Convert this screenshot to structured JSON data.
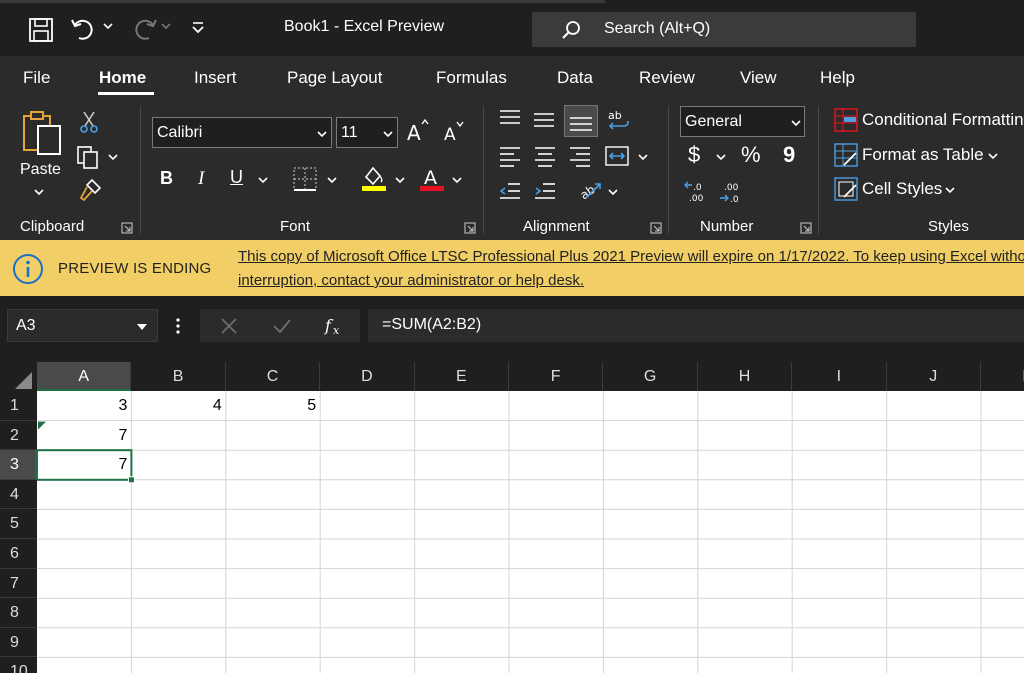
{
  "titlebar": {
    "title": "Book1  -  Excel Preview",
    "search_placeholder": "Search (Alt+Q)"
  },
  "tabs": [
    {
      "label": "File"
    },
    {
      "label": "Home",
      "active": true
    },
    {
      "label": "Insert"
    },
    {
      "label": "Page Layout"
    },
    {
      "label": "Formulas"
    },
    {
      "label": "Data"
    },
    {
      "label": "Review"
    },
    {
      "label": "View"
    },
    {
      "label": "Help"
    }
  ],
  "ribbon": {
    "clipboard": {
      "paste_label": "Paste",
      "group_label": "Clipboard"
    },
    "font": {
      "font_name": "Calibri",
      "font_size": "11",
      "bold": "B",
      "italic": "I",
      "underline": "U",
      "group_label": "Font"
    },
    "alignment": {
      "group_label": "Alignment"
    },
    "number": {
      "format": "General",
      "currency": "$",
      "percent": "%",
      "comma": "9",
      "group_label": "Number"
    },
    "styles": {
      "conditional": "Conditional Formatting",
      "format_table": "Format as Table",
      "cell_styles": "Cell Styles",
      "group_label": "Styles"
    },
    "colors": {
      "highlight": "#ffff00",
      "font_color": "#e81123"
    }
  },
  "banner": {
    "title": "PREVIEW IS ENDING",
    "message_line1": "This copy of Microsoft Office LTSC Professional Plus 2021 Preview will expire on 1/17/2022. To keep using Excel without interruption,",
    "message_line2": "interruption, contact your administrator or help desk.",
    "bg_color": "#f2cf66"
  },
  "formula_bar": {
    "name_box": "A3",
    "formula": "=SUM(A2:B2)"
  },
  "sheet": {
    "columns": [
      "A",
      "B",
      "C",
      "D",
      "E",
      "F",
      "G",
      "H",
      "I",
      "J",
      "K"
    ],
    "rows": [
      "1",
      "2",
      "3",
      "4",
      "5",
      "6",
      "7",
      "8",
      "9",
      "10"
    ],
    "cells": [
      {
        "ref": "A1",
        "value": "3"
      },
      {
        "ref": "B1",
        "value": "4"
      },
      {
        "ref": "C1",
        "value": "5"
      },
      {
        "ref": "A2",
        "value": "7"
      },
      {
        "ref": "A3",
        "value": "7"
      }
    ],
    "selected_cell": "A3",
    "accent": "#1e7145"
  }
}
